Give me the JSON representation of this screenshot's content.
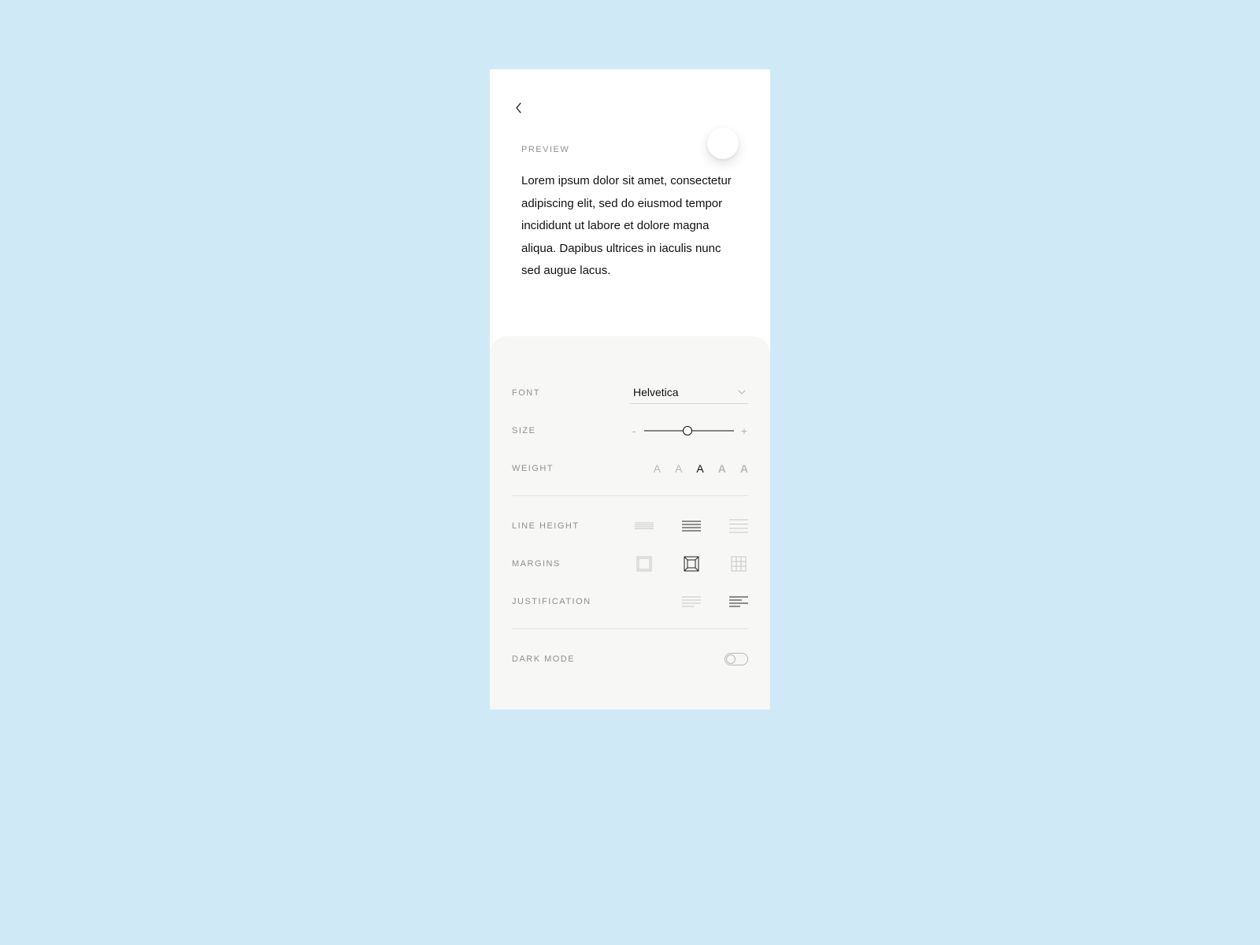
{
  "preview": {
    "label": "PREVIEW",
    "text": "Lorem ipsum dolor sit amet, consectetur adipiscing elit, sed do eiusmod tempor incididunt ut labore et dolore magna aliqua. Dapibus ultrices in iaculis nunc sed augue lacus."
  },
  "settings": {
    "font": {
      "label": "FONT",
      "selected": "Helvetica"
    },
    "size": {
      "label": "SIZE",
      "minus": "-",
      "plus": "+",
      "value_percent": 48
    },
    "weight": {
      "label": "WEIGHT",
      "glyph": "A",
      "options": [
        "thin",
        "light",
        "regular",
        "semibold",
        "heavy"
      ],
      "selected_index": 2
    },
    "line_height": {
      "label": "LINE HEIGHT",
      "options": [
        "tight",
        "normal",
        "loose"
      ],
      "selected_index": 1
    },
    "margins": {
      "label": "MARGINS",
      "options": [
        "narrow",
        "medium",
        "wide"
      ],
      "selected_index": 1
    },
    "justification": {
      "label": "JUSTIFICATION",
      "options": [
        "justify",
        "left"
      ],
      "selected_index": 1
    },
    "dark_mode": {
      "label": "DARK MODE",
      "enabled": false
    }
  }
}
